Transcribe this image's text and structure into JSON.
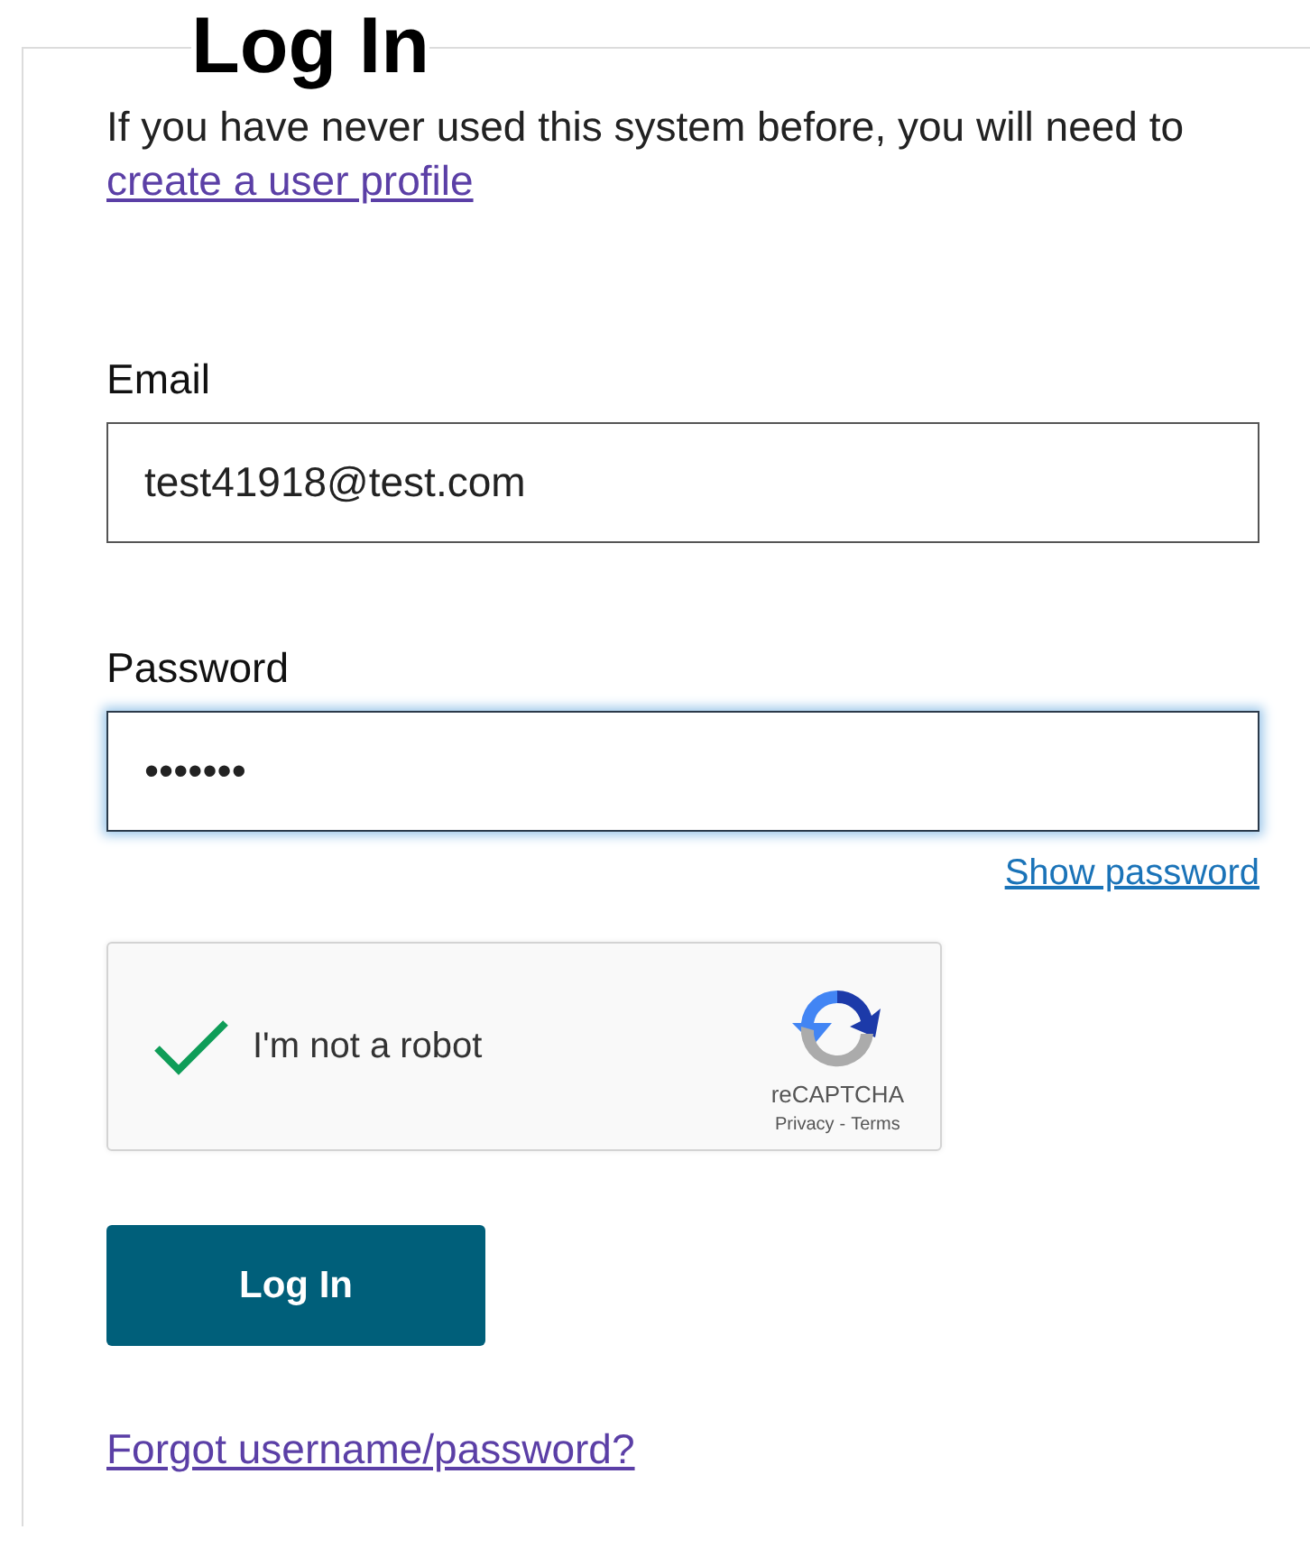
{
  "title": "Log In",
  "intro": {
    "text": "If you have never used this system before, you will need to",
    "link": "create a user profile"
  },
  "fields": [
    {
      "label": "Email",
      "value": "test41918@test.com",
      "focused": false
    },
    {
      "label": "Password",
      "value": "•••••••",
      "focused": true
    }
  ],
  "show_password": "Show password",
  "captcha": {
    "label": "I'm not a robot",
    "checked": true,
    "brand": "reCAPTCHA",
    "privacy": "Privacy",
    "separator": "-",
    "terms": "Terms"
  },
  "submit": "Log In",
  "forgot": "Forgot username/password?"
}
